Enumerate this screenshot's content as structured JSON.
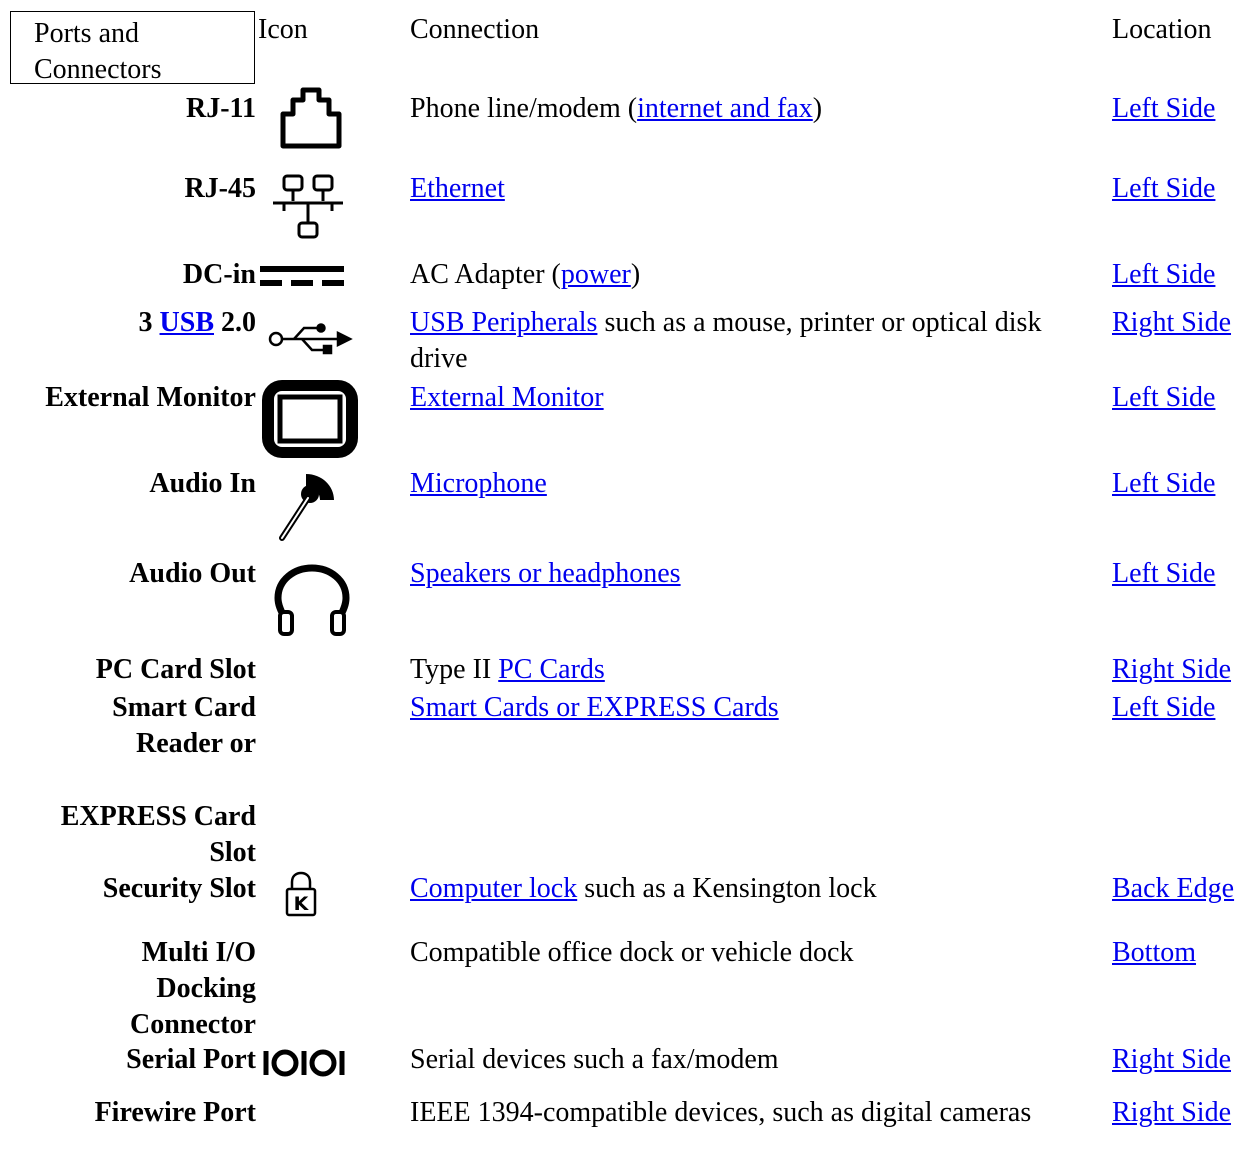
{
  "header": {
    "ports": "Ports and Connectors",
    "icon": "Icon",
    "connection": "Connection",
    "location": "Location"
  },
  "rows": [
    {
      "port": "RJ-11",
      "icon": "phone-jack-icon",
      "conn_pre": "Phone line/modem (",
      "conn_link": "internet and fax",
      "conn_post": ")",
      "location": "Left Side"
    },
    {
      "port": "RJ-45",
      "icon": "network-icon",
      "conn_link": "Ethernet",
      "location": "Left Side"
    },
    {
      "port": "DC-in",
      "icon": "dc-power-icon",
      "conn_pre": "AC Adapter (",
      "conn_link": "power",
      "conn_post": ")",
      "location": "Left Side"
    },
    {
      "port_pre": "3 ",
      "port_link": "USB",
      "port_post": " 2.0",
      "icon": "usb-icon",
      "conn_link": "USB Peripherals",
      "conn_post": " such as a mouse, printer or optical disk drive",
      "location": "Right Side"
    },
    {
      "port": "External Monitor",
      "icon": "monitor-icon",
      "conn_link": "External Monitor",
      "location": "Left Side"
    },
    {
      "port": "Audio In",
      "icon": "microphone-icon",
      "conn_link": "Microphone",
      "location": "Left Side"
    },
    {
      "port": "Audio Out",
      "icon": "headphones-icon",
      "conn_link": "Speakers or headphones",
      "location": "Left Side"
    },
    {
      "port": "PC Card Slot",
      "conn_pre": "Type II ",
      "conn_link": "PC Cards",
      "location": "Right Side"
    },
    {
      "port_line1": "Smart Card",
      "port_line2": "Reader or",
      "port_line3": "EXPRESS Card",
      "port_line4": "Slot",
      "conn_link": "Smart Cards or EXPRESS Cards",
      "location": "Left Side"
    },
    {
      "port": "Security Slot",
      "icon": "kensington-lock-icon",
      "conn_link": "Computer lock",
      "conn_post": " such as a Kensington lock",
      "location": "Back Edge"
    },
    {
      "port_line1": "Multi I/O",
      "port_line2": "Docking",
      "port_line3": "Connector",
      "conn_text": "Compatible office dock or vehicle dock",
      "location": "Bottom"
    },
    {
      "port": "Serial Port",
      "icon": "serial-port-icon",
      "conn_text": "Serial devices such a fax/modem",
      "location": "Right Side"
    },
    {
      "port": "Firewire Port",
      "conn_text": "IEEE 1394-compatible devices, such as digital cameras",
      "location": "Right Side"
    }
  ],
  "colors": {
    "link": "#0000ee",
    "text": "#000000"
  }
}
